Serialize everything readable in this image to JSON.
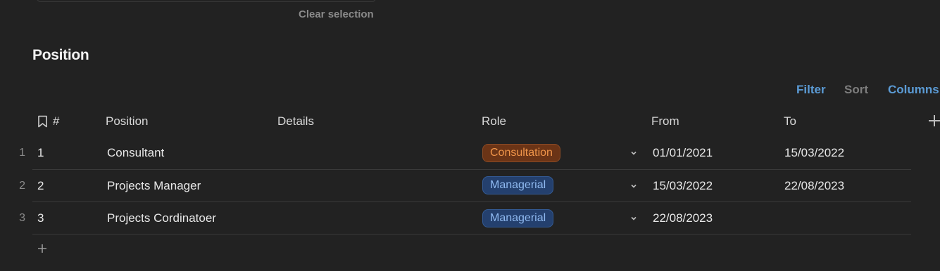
{
  "top": {
    "clear_selection": "Clear selection"
  },
  "section": {
    "title": "Position"
  },
  "toolbar": {
    "filter": "Filter",
    "sort": "Sort",
    "columns": "Columns"
  },
  "table": {
    "headers": {
      "num": "#",
      "position": "Position",
      "details": "Details",
      "role": "Role",
      "from": "From",
      "to": "To"
    },
    "rows": [
      {
        "row_index": "1",
        "num": "1",
        "position": "Consultant",
        "details": "",
        "role": "Consultation",
        "role_color": "orange",
        "from": "01/01/2021",
        "to": "15/03/2022"
      },
      {
        "row_index": "2",
        "num": "2",
        "position": "Projects Manager",
        "details": "",
        "role": "Managerial",
        "role_color": "blue",
        "from": "15/03/2022",
        "to": "22/08/2023"
      },
      {
        "row_index": "3",
        "num": "3",
        "position": "Projects Cordinatoer",
        "details": "",
        "role": "Managerial",
        "role_color": "blue",
        "from": "22/08/2023",
        "to": ""
      }
    ]
  },
  "icons": {
    "bookmark": "bookmark-icon",
    "add_column": "plus-icon",
    "chevron": "chevron-down-icon",
    "add_row": "plus-icon"
  },
  "colors": {
    "background": "#222222",
    "accent": "#5b9bd5",
    "badge_orange": "#6b3416",
    "badge_blue": "#24406e"
  }
}
